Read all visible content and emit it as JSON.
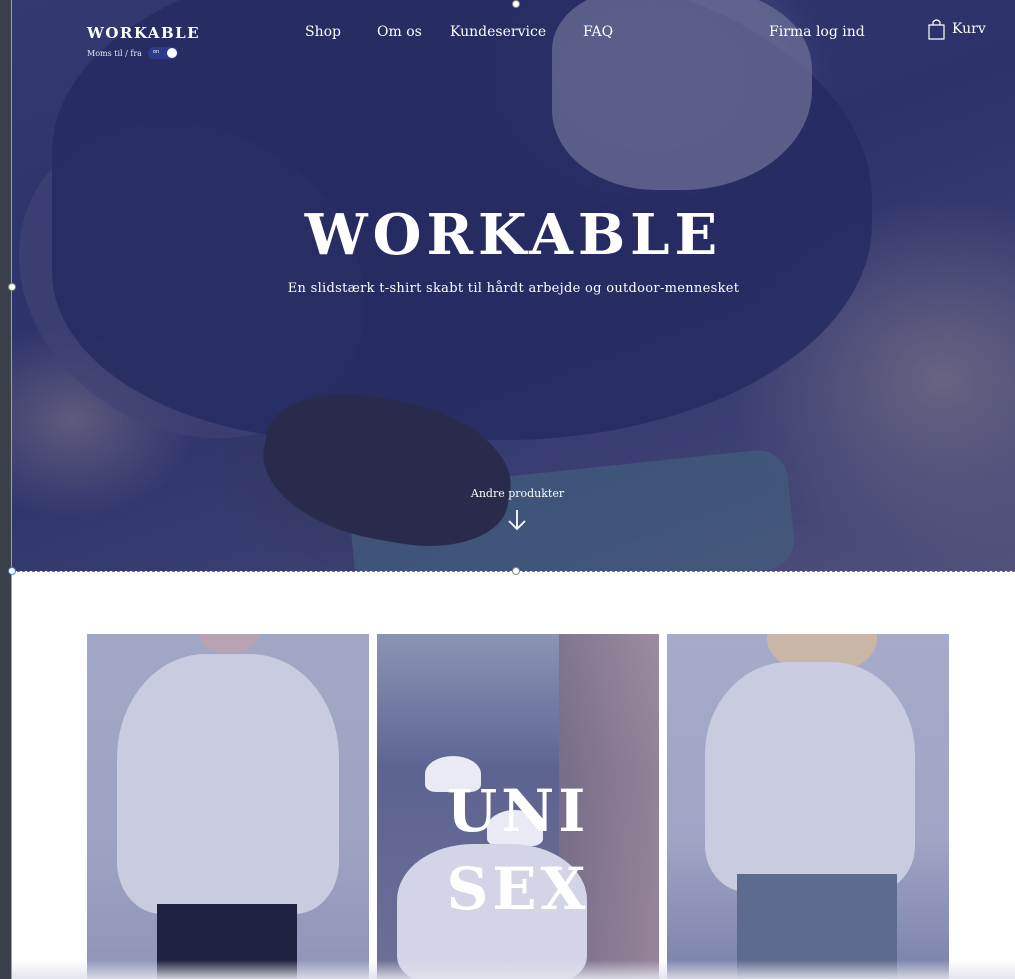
{
  "header": {
    "brand": "WORKABLE",
    "vat_label": "Moms til / fra",
    "vat_toggle_state": "on",
    "nav": {
      "shop": "Shop",
      "about": "Om os",
      "service": "Kundeservice",
      "faq": "FAQ",
      "company_login": "Firma log ind",
      "cart": "Kurv"
    }
  },
  "hero": {
    "title": "WORKABLE",
    "subtitle": "En slidstærk t-shirt skabt til hårdt arbejde og outdoor-mennesket",
    "more_link": "Andre produkter",
    "arrow_icon": "arrow-down-icon"
  },
  "products": {
    "center_line_1": "UNI",
    "center_line_2": "SEX"
  },
  "colors": {
    "overlay": "#2d3270",
    "white": "#ffffff",
    "selection": "#3b7de0"
  }
}
